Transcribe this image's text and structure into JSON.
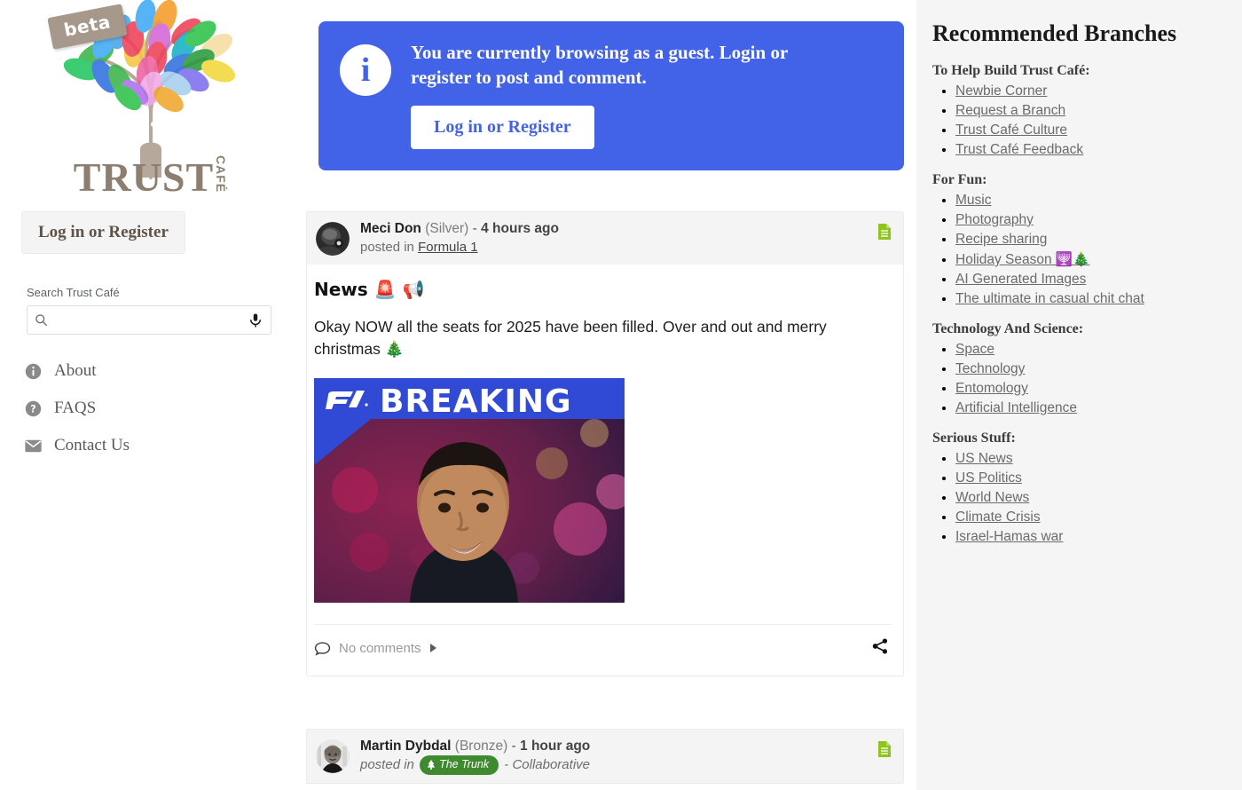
{
  "brand": {
    "beta_label": "beta",
    "name_main": "TRUST",
    "name_sub": "CAFÉ",
    "logo_icon": "tree-logo"
  },
  "sidebar": {
    "login_button": "Log in or Register",
    "search_label": "Search Trust Café",
    "search_value": "",
    "search_placeholder": "",
    "search_icon": "search-icon",
    "mic_icon": "microphone-icon",
    "nav": [
      {
        "label": "About",
        "icon": "info-circle-icon"
      },
      {
        "label": "FAQS",
        "icon": "question-circle-icon"
      },
      {
        "label": "Contact Us",
        "icon": "envelope-icon"
      }
    ]
  },
  "guest_banner": {
    "icon": "info-icon",
    "message": "You are currently browsing as a guest. Login or register to post and comment.",
    "button_label": "Log in or Register",
    "bg_color": "#4263e8",
    "text_color": "#ffffff"
  },
  "posts": [
    {
      "author": "Meci Don",
      "rank": "(Silver)",
      "separator": "-",
      "time": "4 hours ago",
      "posted_in_label": "posted in",
      "branch": "Formula 1",
      "branch_is_badge": false,
      "suffix": "",
      "doc_icon": "document-icon",
      "doc_icon_color": "#8fc320",
      "avatar_icon": "user-avatar",
      "title": "News 🚨 📢",
      "body": "Okay NOW all the seats for 2025 have been filled. Over and out and merry christmas 🎄",
      "image": {
        "caption": "BREAKING",
        "logo": "f1-logo",
        "alt": "F1 BREAKING news graphic with driver portrait"
      },
      "comments_label": "No comments",
      "comments_icon": "comment-bubble-icon",
      "expand_icon": "triangle-right-icon",
      "share_icon": "share-icon"
    },
    {
      "author": "Martin Dybdal",
      "rank": "(Bronze)",
      "separator": "-",
      "time": "1 hour ago",
      "posted_in_label": "posted in",
      "branch": "The Trunk",
      "branch_is_badge": true,
      "branch_badge_icon": "tree-icon",
      "branch_badge_color": "#3f8a2e",
      "suffix": "- Collaborative",
      "doc_icon": "document-icon",
      "doc_icon_color": "#8fc320",
      "avatar_icon": "user-avatar"
    }
  ],
  "recommended": {
    "title": "Recommended Branches",
    "groups": [
      {
        "heading": "To Help Build Trust Café:",
        "items": [
          {
            "label": "Newbie Corner"
          },
          {
            "label": "Request a Branch"
          },
          {
            "label": "Trust Café Culture"
          },
          {
            "label": "Trust Café Feedback"
          }
        ]
      },
      {
        "heading": "For Fun:",
        "items": [
          {
            "label": "Music"
          },
          {
            "label": "Photography"
          },
          {
            "label": "Recipe sharing"
          },
          {
            "label": "Holiday Season 🕎🎄"
          },
          {
            "label": "AI Generated Images"
          },
          {
            "label": "The ultimate in casual chit chat"
          }
        ]
      },
      {
        "heading": "Technology And Science:",
        "items": [
          {
            "label": "Space"
          },
          {
            "label": "Technology"
          },
          {
            "label": "Entomology"
          },
          {
            "label": "Artificial Intelligence"
          }
        ]
      },
      {
        "heading": "Serious Stuff:",
        "items": [
          {
            "label": "US News"
          },
          {
            "label": "US Politics"
          },
          {
            "label": "World News"
          },
          {
            "label": "Climate Crisis"
          },
          {
            "label": "Israel-Hamas war"
          }
        ]
      }
    ]
  }
}
